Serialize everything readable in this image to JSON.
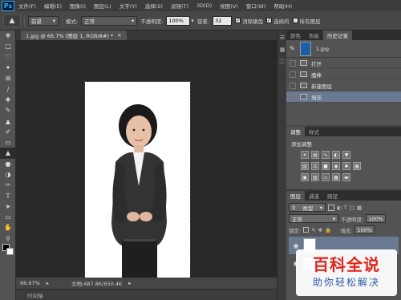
{
  "app": {
    "logo": "Ps"
  },
  "menu": [
    "文件(F)",
    "编辑(E)",
    "图像(I)",
    "图层(L)",
    "文字(Y)",
    "选择(S)",
    "滤镜(T)",
    "3D(D)",
    "视图(V)",
    "窗口(W)",
    "帮助(H)"
  ],
  "options": {
    "source": "前景",
    "mode_label": "模式:",
    "mode_value": "正常",
    "opacity_label": "不透明度:",
    "opacity_value": "100%",
    "tolerance_label": "容差:",
    "tolerance_value": "32",
    "antialias_label": "消除锯齿",
    "contiguous_label": "连续的",
    "all_layers_label": "所有图层"
  },
  "document": {
    "tab_title": "1.jpg @ 66.7% (图层 1, RGB/8#) *",
    "close": "×"
  },
  "status": {
    "zoom": "66.67%",
    "doc_info": "文档:487.8K/650.4K"
  },
  "timeline": {
    "label": "时间轴"
  },
  "history": {
    "tabs": [
      "颜色",
      "色板",
      "历史记录"
    ],
    "snapshot": "1.jpg",
    "items": [
      "打开",
      "魔棒",
      "新建图层",
      "填充"
    ],
    "selected_index": 3
  },
  "adjustments": {
    "tabs": [
      "调整",
      "样式"
    ],
    "title": "添加调整"
  },
  "layers": {
    "tabs": [
      "图层",
      "通道",
      "路径"
    ],
    "filter_label": "类型",
    "blend_mode": "正常",
    "opacity_label": "不透明度:",
    "opacity_value": "100%",
    "lock_label": "锁定:",
    "fill_label": "填充:",
    "fill_value": "100%"
  },
  "watermark": {
    "title": "百科全说",
    "subtitle": "助你轻松解决"
  },
  "colors": {
    "accent": "#31a8ff",
    "selection": "#6a7992",
    "watermark_red": "#e1251b",
    "watermark_blue": "#2d5ca8"
  }
}
